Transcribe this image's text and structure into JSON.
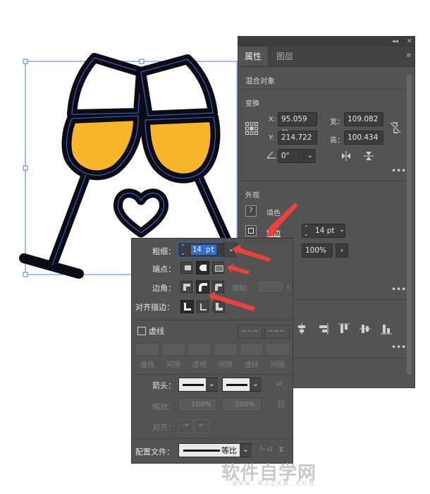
{
  "panel": {
    "tabs": [
      "属性",
      "图层"
    ],
    "object_type": "混合对象",
    "transform": {
      "title": "变换",
      "x_label": "X:",
      "x_value": "95.059 m",
      "y_label": "Y:",
      "y_value": "214.722",
      "w_label": "宽：",
      "w_value": "109.082",
      "h_label": "高：",
      "h_value": "100.434",
      "angle_value": "0°"
    },
    "appearance": {
      "title": "外观",
      "fill_label": "填色",
      "stroke_label": "描边",
      "stroke_weight": "14 pt",
      "opacity": "100%"
    }
  },
  "stroke_popup": {
    "weight_label": "粗细：",
    "weight_value": "14 pt",
    "cap_label": "端点：",
    "corner_label": "边角：",
    "limit_label": "限制：",
    "limit_suffix": "x",
    "align_label": "对齐描边：",
    "dashed_label": "虚线",
    "dash_labels": [
      "虚线",
      "间隙",
      "虚线",
      "间隙",
      "虚线",
      "间隙"
    ],
    "arrow_label": "箭头：",
    "scale_label": "缩放：",
    "scale_left": "100%",
    "scale_right": "100%",
    "align_arrow_label": "对齐：",
    "profile_label": "配置文件：",
    "profile_value": "等比"
  },
  "colors": {
    "panel_bg": "#535353",
    "wine_fill": "#f7b52c",
    "outline": "#0a0a14",
    "selection": "#3b6fe0",
    "annotation_arrow": "#f0403a"
  },
  "watermark": {
    "main": "软件自学网",
    "sub": "WWW.RJZXW.COM"
  }
}
